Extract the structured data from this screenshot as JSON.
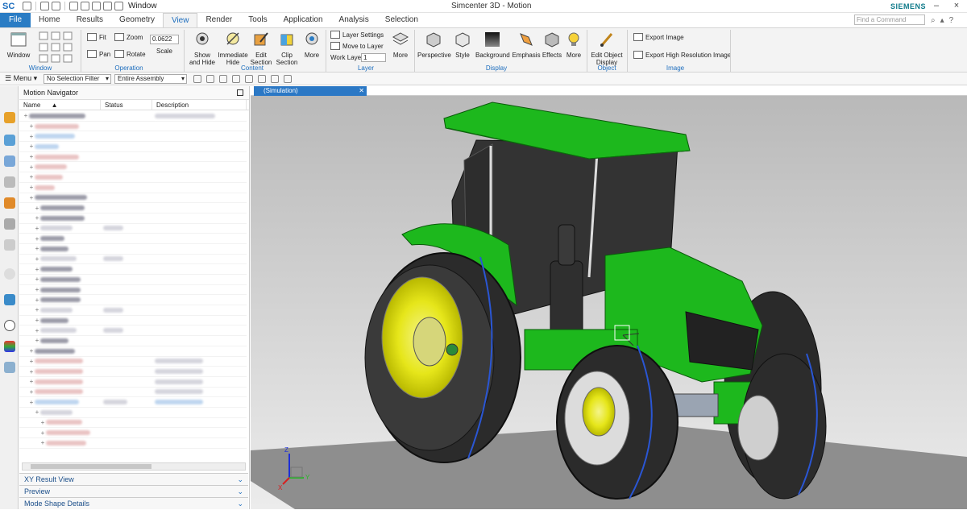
{
  "app": {
    "logo": "SC",
    "window_menu": "Window",
    "title": "Simcenter 3D - Motion",
    "brand": "SIEMENS",
    "search_placeholder": "Find a Command"
  },
  "tabs": [
    "File",
    "Home",
    "Results",
    "Geometry",
    "View",
    "Render",
    "Tools",
    "Application",
    "Analysis",
    "Selection"
  ],
  "active_tab": "View",
  "ribbon": {
    "window": {
      "button": "Window",
      "group": "Window"
    },
    "operation": {
      "fit": "Fit",
      "pan": "Pan",
      "zoom": "Zoom",
      "rotate": "Rotate",
      "scale_value": "0.0622",
      "scale_label": "Scale",
      "group": "Operation"
    },
    "content": {
      "show_hide_1": "Show",
      "show_hide_2": "and Hide",
      "immediate_hide_1": "Immediate",
      "immediate_hide_2": "Hide",
      "edit_section_1": "Edit",
      "edit_section_2": "Section",
      "clip_section_1": "Clip",
      "clip_section_2": "Section",
      "more": "More",
      "group": "Content"
    },
    "layer": {
      "layer_settings": "Layer Settings",
      "move_to_layer": "Move to Layer",
      "work_layer": "Work Layer",
      "work_layer_value": "1",
      "more": "More",
      "group": "Layer"
    },
    "display": {
      "perspective": "Perspective",
      "style": "Style",
      "background": "Background",
      "emphasis": "Emphasis",
      "effects": "Effects",
      "more": "More",
      "group": "Display"
    },
    "object": {
      "edit_1": "Edit Object",
      "edit_2": "Display",
      "group": "Object"
    },
    "image": {
      "export": "Export Image",
      "export_hr": "Export High Resolution Image",
      "group": "Image"
    }
  },
  "selection_bar": {
    "menu": "Menu",
    "filter": "No Selection Filter",
    "scope": "Entire Assembly"
  },
  "navigator": {
    "title": "Motion Navigator",
    "columns": [
      "Name",
      "Status",
      "Description"
    ]
  },
  "panels": [
    "XY Result View",
    "Preview",
    "Mode Shape Details"
  ],
  "viewport": {
    "tab_label": "(Simulation)",
    "triad_labels": [
      "Z",
      "Y",
      "X"
    ]
  },
  "colors": {
    "accent": "#2b78c5",
    "body_green": "#1db81d",
    "rim_yellow": "#e6e61a",
    "background_top": "#b9b9b9",
    "background_bottom": "#ececec",
    "ground": "#8e8e8e"
  }
}
